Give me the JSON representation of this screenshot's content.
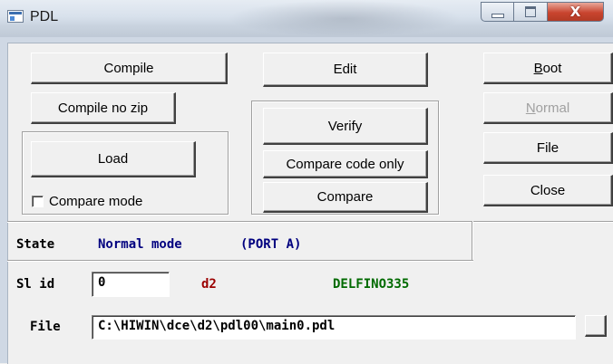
{
  "window": {
    "title": "PDL",
    "close_glyph": "X",
    "icons": [
      "app-icon",
      "minimize-icon",
      "maximize-icon",
      "close-icon"
    ]
  },
  "buttons": {
    "compile": "Compile",
    "compile_no_zip": "Compile no zip",
    "load": "Load",
    "edit": "Edit",
    "verify": "Verify",
    "compare_code_only": "Compare code only",
    "compare": "Compare",
    "boot_first": "B",
    "boot_rest": "oot",
    "normal_first": "N",
    "normal_rest": "ormal",
    "file": "File",
    "close": "Close",
    "browse": ""
  },
  "compare_mode": {
    "label": "Compare mode",
    "checked": false
  },
  "state": {
    "label": "State",
    "value": "Normal mode",
    "port": "(PORT A)"
  },
  "slave": {
    "label": "Sl id",
    "id_value": "0",
    "name": "d2",
    "device": "DELFINO335"
  },
  "file": {
    "label": "File",
    "path": "C:\\HIWIN\\dce\\d2\\pdl00\\main0.pdl"
  },
  "colors": {
    "state_label": "#000000",
    "state_value": "#00007f",
    "name_red": "#9b0000",
    "device_green": "#006a00"
  }
}
